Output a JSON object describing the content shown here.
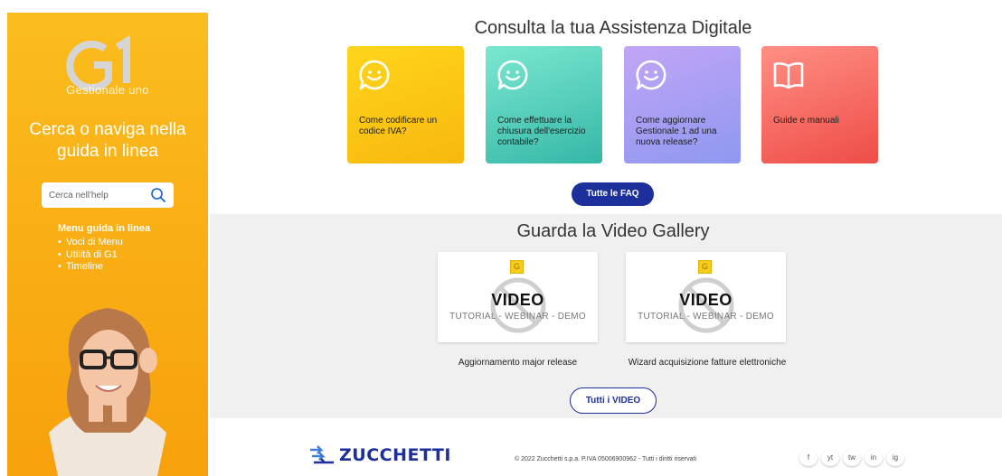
{
  "sidebar": {
    "logo_text": "G1",
    "logo_subtitle": "Gestionale uno",
    "title": "Cerca o naviga nella guida in linea",
    "search": {
      "placeholder": "Cerca nell'help"
    },
    "menu_heading": "Menu guida in linea",
    "menu_items": [
      "Voci di Menu",
      "Utilità di G1",
      "Timeline"
    ]
  },
  "main": {
    "title": "Consulta la tua Assistenza Digitale",
    "cards": [
      {
        "label": "Come codificare un codice IVA?",
        "icon": "smile-chat-icon"
      },
      {
        "label": "Come effettuare la chiusura dell'esercizio contabile?",
        "icon": "smile-chat-icon"
      },
      {
        "label": "Come aggiornare Gestionale 1 ad una nuova release?",
        "icon": "smile-chat-icon"
      },
      {
        "label": "Guide e manuali",
        "icon": "book-icon"
      }
    ],
    "faq_button": "Tutte le FAQ"
  },
  "video": {
    "title": "Guarda la Video Gallery",
    "badge": "G",
    "video_word": "VIDEO",
    "video_sub": "TUTORIAL - WEBINAR - DEMO",
    "captions": [
      "Aggiornamento major release",
      "Wizard acquisizione fatture elettroniche"
    ],
    "all_button": "Tutti i VIDEO"
  },
  "footer": {
    "brand": "ZUCCHETTI",
    "copyright": "© 2022 Zucchetti s.p.a. P.IVA 05006900962 - Tutti i diritti riservati",
    "social": [
      "f",
      "yt",
      "tw",
      "in",
      "ig"
    ]
  },
  "colors": {
    "sidebar": "#f9ad13",
    "primary_blue": "#1d2f9a",
    "card_yellow": "#f7b80d",
    "card_teal": "#35b7a8",
    "card_purple": "#8e98f0",
    "card_red": "#ee4d47"
  }
}
